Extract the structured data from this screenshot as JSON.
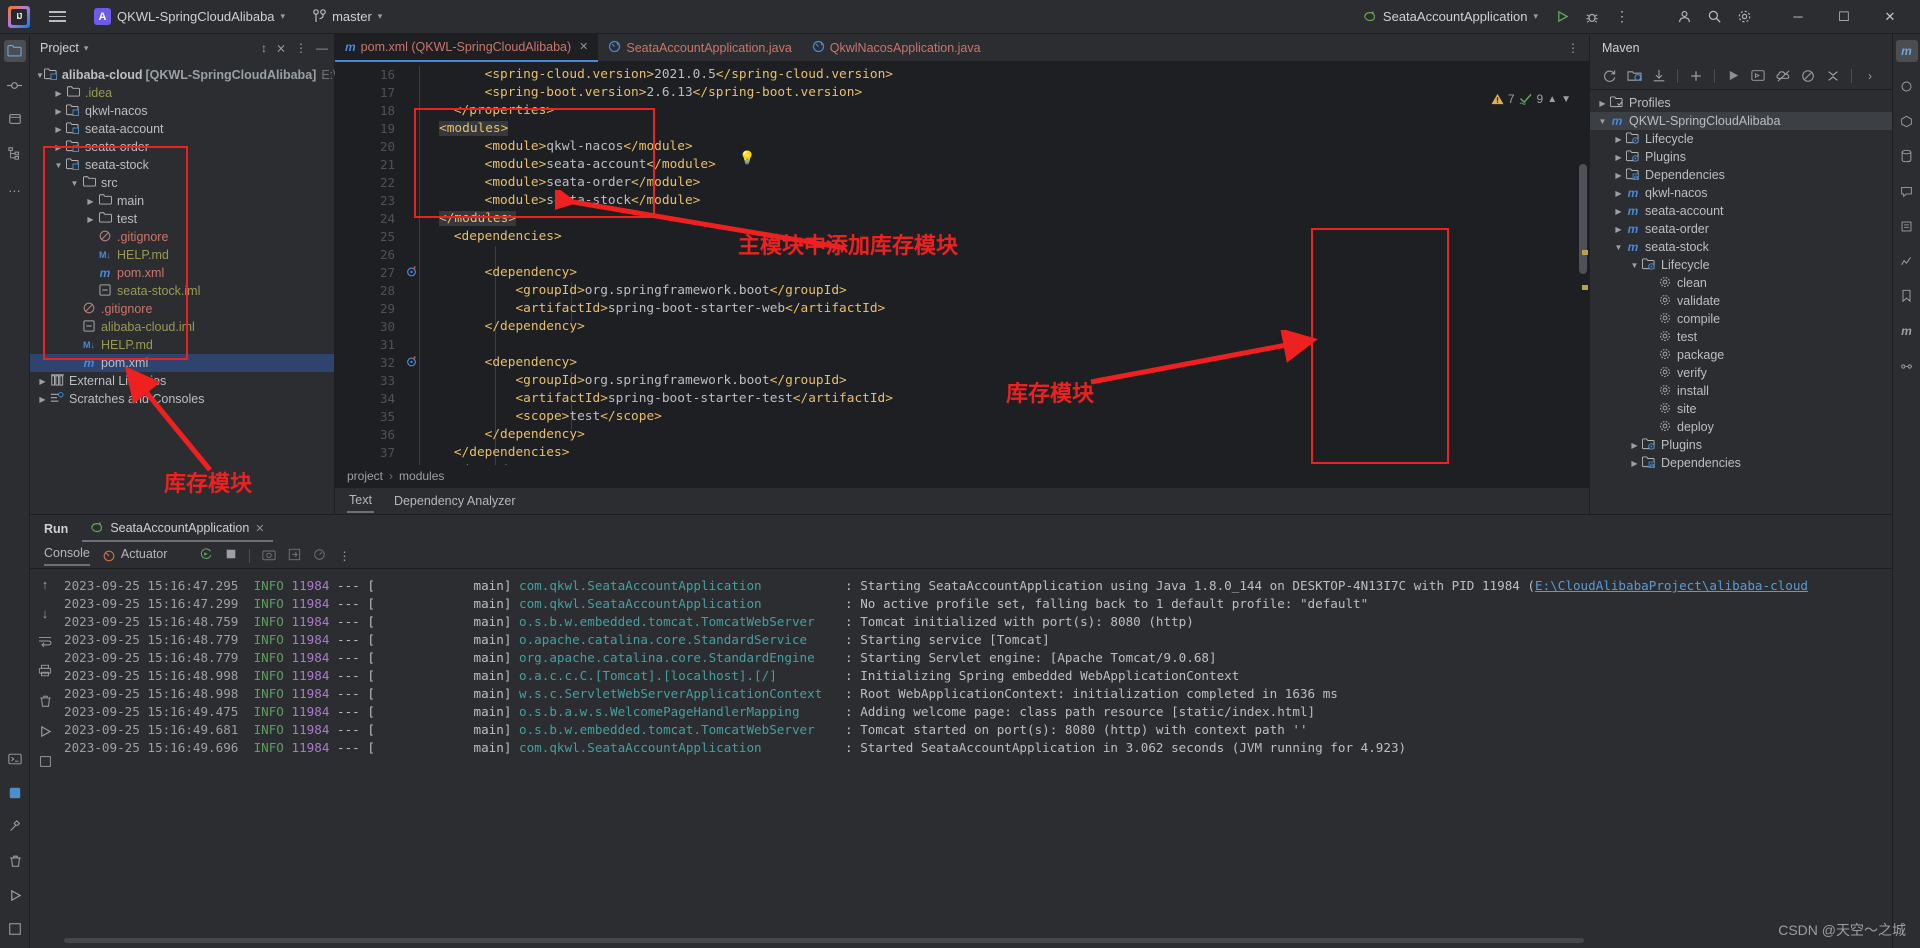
{
  "topbar": {
    "logo": "IJ",
    "project_badge": "A",
    "project_name": "QKWL-SpringCloudAlibaba",
    "branch": "master",
    "run_config": "SeataAccountApplication",
    "icons": {
      "hamburger": "menu-icon",
      "branch": "vcs-branch-icon",
      "run": "run-icon",
      "debug": "debug-icon",
      "more": "more-vertical-icon",
      "account": "account-icon",
      "search": "search-icon",
      "settings": "settings-icon",
      "minimize": "─",
      "maximize": "☐",
      "close": "✕"
    }
  },
  "project_panel": {
    "title": "Project",
    "actions": [
      "collapse-expand-icon",
      "collapse-all-icon",
      "options-icon",
      "hide-icon"
    ],
    "tree": [
      {
        "depth": 0,
        "arrow": "down",
        "icon": "module-folder",
        "label": "alibaba-cloud",
        "suffix": "[QKWL-SpringCloudAlibaba]",
        "path": "E:\\CloudA",
        "cls": "c-white",
        "bold": true
      },
      {
        "depth": 1,
        "arrow": "right",
        "icon": "folder",
        "label": ".idea",
        "cls": "c-olive"
      },
      {
        "depth": 1,
        "arrow": "right",
        "icon": "module-folder",
        "label": "qkwl-nacos",
        "cls": "c-white"
      },
      {
        "depth": 1,
        "arrow": "right",
        "icon": "module-folder",
        "label": "seata-account",
        "cls": "c-white"
      },
      {
        "depth": 1,
        "arrow": "right",
        "icon": "module-folder",
        "label": "seata-order",
        "cls": "c-white"
      },
      {
        "depth": 1,
        "arrow": "down",
        "icon": "module-folder",
        "label": "seata-stock",
        "cls": "c-white"
      },
      {
        "depth": 2,
        "arrow": "down",
        "icon": "folder",
        "label": "src",
        "cls": "c-white"
      },
      {
        "depth": 3,
        "arrow": "right",
        "icon": "folder",
        "label": "main",
        "cls": "c-white"
      },
      {
        "depth": 3,
        "arrow": "right",
        "icon": "folder",
        "label": "test",
        "cls": "c-white"
      },
      {
        "depth": 3,
        "arrow": "none",
        "icon": "gitignore",
        "label": ".gitignore",
        "cls": "c-red"
      },
      {
        "depth": 3,
        "arrow": "none",
        "icon": "markdown",
        "label": "HELP.md",
        "cls": "c-olive"
      },
      {
        "depth": 3,
        "arrow": "none",
        "icon": "maven",
        "label": "pom.xml",
        "cls": "c-red"
      },
      {
        "depth": 3,
        "arrow": "none",
        "icon": "iml",
        "label": "seata-stock.iml",
        "cls": "c-olive"
      },
      {
        "depth": 2,
        "arrow": "none",
        "icon": "gitignore",
        "label": ".gitignore",
        "cls": "c-red"
      },
      {
        "depth": 2,
        "arrow": "none",
        "icon": "iml",
        "label": "alibaba-cloud.iml",
        "cls": "c-olive"
      },
      {
        "depth": 2,
        "arrow": "none",
        "icon": "markdown",
        "label": "HELP.md",
        "cls": "c-olive"
      },
      {
        "depth": 2,
        "arrow": "none",
        "icon": "maven",
        "label": "pom.xml",
        "cls": "c-white",
        "selected": true
      },
      {
        "depth": 0,
        "arrow": "right",
        "icon": "library",
        "label": "External Libraries",
        "cls": "c-white"
      },
      {
        "depth": 0,
        "arrow": "right",
        "icon": "scratches",
        "label": "Scratches and Consoles",
        "cls": "c-white"
      }
    ]
  },
  "editor": {
    "tabs": [
      {
        "icon": "maven",
        "label": "pom.xml (QKWL-SpringCloudAlibaba)",
        "active": true,
        "closable": true
      },
      {
        "icon": "java",
        "label": "SeataAccountApplication.java",
        "active": false
      },
      {
        "icon": "java",
        "label": "QkwlNacosApplication.java",
        "active": false
      }
    ],
    "inspection": {
      "warning_count": "7",
      "ok_count": "9"
    },
    "breadcrumbs": [
      "project",
      "modules"
    ],
    "bottom_tabs": [
      {
        "label": "Text",
        "active": true
      },
      {
        "label": "Dependency Analyzer",
        "active": false
      }
    ],
    "lines": [
      {
        "no": "16",
        "text": "        <spring-cloud.version>2021.0.5</spring-cloud.version>"
      },
      {
        "no": "17",
        "text": "        <spring-boot.version>2.6.13</spring-boot.version>"
      },
      {
        "no": "18",
        "text": "    </properties>",
        "bulb": true
      },
      {
        "no": "19",
        "text": "    <modules>",
        "highlight": true
      },
      {
        "no": "20",
        "text": "        <module>qkwl-nacos</module>"
      },
      {
        "no": "21",
        "text": "        <module>seata-account</module>"
      },
      {
        "no": "22",
        "text": "        <module>seata-order</module>"
      },
      {
        "no": "23",
        "text": "        <module>seata-stock</module>"
      },
      {
        "no": "24",
        "text": "    </modules>",
        "highlight": true
      },
      {
        "no": "25",
        "text": "    <dependencies>"
      },
      {
        "no": "26",
        "text": ""
      },
      {
        "no": "27",
        "text": "        <dependency>",
        "mark": "run-gutter"
      },
      {
        "no": "28",
        "text": "            <groupId>org.springframework.boot</groupId>"
      },
      {
        "no": "29",
        "text": "            <artifactId>spring-boot-starter-web</artifactId>"
      },
      {
        "no": "30",
        "text": "        </dependency>"
      },
      {
        "no": "31",
        "text": ""
      },
      {
        "no": "32",
        "text": "        <dependency>",
        "mark": "run-gutter"
      },
      {
        "no": "33",
        "text": "            <groupId>org.springframework.boot</groupId>"
      },
      {
        "no": "34",
        "text": "            <artifactId>spring-boot-starter-test</artifactId>"
      },
      {
        "no": "35",
        "text": "            <scope>test</scope>"
      },
      {
        "no": "36",
        "text": "        </dependency>"
      },
      {
        "no": "37",
        "text": "    </dependencies>"
      },
      {
        "no": "38",
        "text": "    <dependencyManagement>"
      }
    ]
  },
  "maven_panel": {
    "title": "Maven",
    "toolbar_icons": [
      "reload-icon",
      "add-maven-project-icon",
      "download-sources-icon",
      "plus-icon",
      "run-icon",
      "execute-goal-icon",
      "toggle-offline-icon",
      "skip-tests-icon",
      "collapse-all-icon",
      "chevron-right-icon"
    ],
    "tree": [
      {
        "depth": 0,
        "arrow": "right",
        "icon": "folder-profiles",
        "label": "Profiles"
      },
      {
        "depth": 0,
        "arrow": "down",
        "icon": "maven",
        "label": "QKWL-SpringCloudAlibaba",
        "selected": true
      },
      {
        "depth": 1,
        "arrow": "right",
        "icon": "folder-lifecycle",
        "label": "Lifecycle"
      },
      {
        "depth": 1,
        "arrow": "right",
        "icon": "folder-plugins",
        "label": "Plugins"
      },
      {
        "depth": 1,
        "arrow": "right",
        "icon": "folder-deps",
        "label": "Dependencies"
      },
      {
        "depth": 1,
        "arrow": "right",
        "icon": "maven",
        "label": "qkwl-nacos"
      },
      {
        "depth": 1,
        "arrow": "right",
        "icon": "maven",
        "label": "seata-account"
      },
      {
        "depth": 1,
        "arrow": "right",
        "icon": "maven",
        "label": "seata-order"
      },
      {
        "depth": 1,
        "arrow": "down",
        "icon": "maven",
        "label": "seata-stock"
      },
      {
        "depth": 2,
        "arrow": "down",
        "icon": "folder-lifecycle",
        "label": "Lifecycle"
      },
      {
        "depth": 3,
        "arrow": "none",
        "icon": "gear",
        "label": "clean"
      },
      {
        "depth": 3,
        "arrow": "none",
        "icon": "gear",
        "label": "validate"
      },
      {
        "depth": 3,
        "arrow": "none",
        "icon": "gear",
        "label": "compile"
      },
      {
        "depth": 3,
        "arrow": "none",
        "icon": "gear",
        "label": "test"
      },
      {
        "depth": 3,
        "arrow": "none",
        "icon": "gear",
        "label": "package"
      },
      {
        "depth": 3,
        "arrow": "none",
        "icon": "gear",
        "label": "verify"
      },
      {
        "depth": 3,
        "arrow": "none",
        "icon": "gear",
        "label": "install"
      },
      {
        "depth": 3,
        "arrow": "none",
        "icon": "gear",
        "label": "site"
      },
      {
        "depth": 3,
        "arrow": "none",
        "icon": "gear",
        "label": "deploy"
      },
      {
        "depth": 2,
        "arrow": "right",
        "icon": "folder-plugins",
        "label": "Plugins"
      },
      {
        "depth": 2,
        "arrow": "right",
        "icon": "folder-deps",
        "label": "Dependencies"
      }
    ]
  },
  "run_panel": {
    "title": "Run",
    "tab_label": "SeataAccountApplication",
    "toolbar": [
      {
        "label": "Console",
        "active": true
      },
      {
        "label": "Actuator",
        "active": false,
        "icon": "actuator-icon"
      }
    ],
    "toolbar_icons": [
      "rerun-icon",
      "stop-icon",
      "screenshot-icon",
      "export-icon",
      "profile-icon",
      "more-vertical-icon"
    ],
    "side_icons": [
      "scroll-up-icon",
      "scroll-down-icon",
      "soft-wrap-icon",
      "print-icon",
      "clear-all-icon",
      "run-icon",
      "settings-icon"
    ],
    "log": [
      {
        "ts": "2023-09-25 15:16:47.295",
        "level": "INFO",
        "pid": "11984",
        "thread": "main",
        "class": "com.qkwl.SeataAccountApplication",
        "msg": "Starting SeataAccountApplication using Java 1.8.0_144 on DESKTOP-4N13I7C with PID 11984 (",
        "link": "E:\\CloudAlibabaProject\\alibaba-cloud"
      },
      {
        "ts": "2023-09-25 15:16:47.299",
        "level": "INFO",
        "pid": "11984",
        "thread": "main",
        "class": "com.qkwl.SeataAccountApplication",
        "msg": "No active profile set, falling back to 1 default profile: \"default\""
      },
      {
        "ts": "2023-09-25 15:16:48.759",
        "level": "INFO",
        "pid": "11984",
        "thread": "main",
        "class": "o.s.b.w.embedded.tomcat.TomcatWebServer",
        "msg": "Tomcat initialized with port(s): 8080 (http)"
      },
      {
        "ts": "2023-09-25 15:16:48.779",
        "level": "INFO",
        "pid": "11984",
        "thread": "main",
        "class": "o.apache.catalina.core.StandardService",
        "msg": "Starting service [Tomcat]"
      },
      {
        "ts": "2023-09-25 15:16:48.779",
        "level": "INFO",
        "pid": "11984",
        "thread": "main",
        "class": "org.apache.catalina.core.StandardEngine",
        "msg": "Starting Servlet engine: [Apache Tomcat/9.0.68]"
      },
      {
        "ts": "2023-09-25 15:16:48.998",
        "level": "INFO",
        "pid": "11984",
        "thread": "main",
        "class": "o.a.c.c.C.[Tomcat].[localhost].[/]",
        "msg": "Initializing Spring embedded WebApplicationContext"
      },
      {
        "ts": "2023-09-25 15:16:48.998",
        "level": "INFO",
        "pid": "11984",
        "thread": "main",
        "class": "w.s.c.ServletWebServerApplicationContext",
        "msg": "Root WebApplicationContext: initialization completed in 1636 ms"
      },
      {
        "ts": "2023-09-25 15:16:49.475",
        "level": "INFO",
        "pid": "11984",
        "thread": "main",
        "class": "o.s.b.a.w.s.WelcomePageHandlerMapping",
        "msg": "Adding welcome page: class path resource [static/index.html]"
      },
      {
        "ts": "2023-09-25 15:16:49.681",
        "level": "INFO",
        "pid": "11984",
        "thread": "main",
        "class": "o.s.b.w.embedded.tomcat.TomcatWebServer",
        "msg": "Tomcat started on port(s): 8080 (http) with context path ''"
      },
      {
        "ts": "2023-09-25 15:16:49.696",
        "level": "INFO",
        "pid": "11984",
        "thread": "main",
        "class": "com.qkwl.SeataAccountApplication",
        "msg": "Started SeataAccountApplication in 3.062 seconds (JVM running for 4.923)"
      }
    ]
  },
  "annotations": {
    "label_modules_editor": "主模块中添加库存模块",
    "label_stock_maven": "库存模块",
    "label_stock_tree": "库存模块",
    "accent_red": "#ef2020"
  },
  "watermark": "CSDN @天空～之城"
}
